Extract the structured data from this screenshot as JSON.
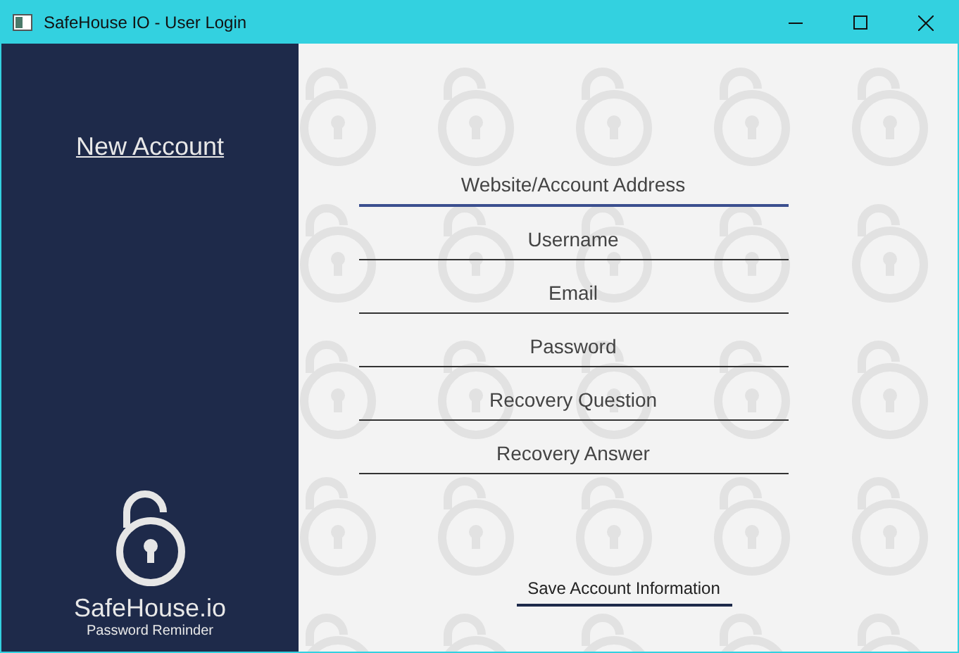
{
  "window": {
    "title": "SafeHouse IO - User Login"
  },
  "sidebar": {
    "link": "New Account",
    "brand": "SafeHouse.io",
    "tagline": "Password Reminder"
  },
  "fields": [
    {
      "placeholder": "Website/Account Address",
      "focused": true
    },
    {
      "placeholder": "Username",
      "focused": false
    },
    {
      "placeholder": "Email",
      "focused": false
    },
    {
      "placeholder": "Password",
      "focused": false
    },
    {
      "placeholder": "Recovery Question",
      "focused": false
    },
    {
      "placeholder": "Recovery Answer",
      "focused": false
    }
  ],
  "save_button": "Save Account Information"
}
